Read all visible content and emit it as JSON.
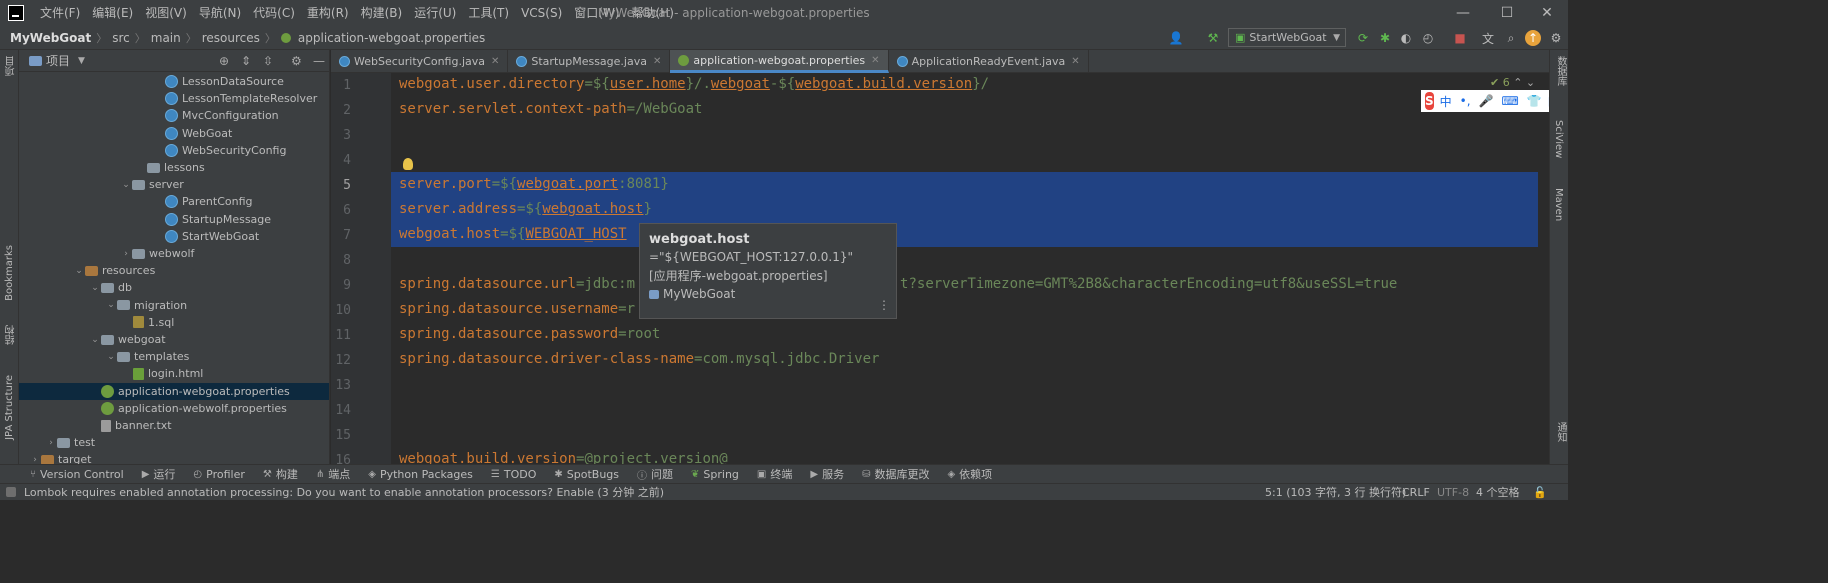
{
  "menu": [
    "文件(F)",
    "编辑(E)",
    "视图(V)",
    "导航(N)",
    "代码(C)",
    "重构(R)",
    "构建(B)",
    "运行(U)",
    "工具(T)",
    "VCS(S)",
    "窗口(W)",
    "帮助(H)"
  ],
  "window_title": "MyWebGoat - application-webgoat.properties",
  "breadcrumb": [
    "MyWebGoat",
    "src",
    "main",
    "resources",
    "application-webgoat.properties"
  ],
  "run_config": "StartWebGoat",
  "project_panel": {
    "title": "项目"
  },
  "tree": [
    {
      "label": "LessonDataSource",
      "icon": "class"
    },
    {
      "label": "LessonTemplateResolver",
      "icon": "class"
    },
    {
      "label": "MvcConfiguration",
      "icon": "class"
    },
    {
      "label": "WebGoat",
      "icon": "class"
    },
    {
      "label": "WebSecurityConfig",
      "icon": "class"
    },
    {
      "label": "lessons",
      "icon": "folder"
    },
    {
      "label": "server",
      "icon": "folder"
    },
    {
      "label": "ParentConfig",
      "icon": "class"
    },
    {
      "label": "StartupMessage",
      "icon": "class"
    },
    {
      "label": "StartWebGoat",
      "icon": "class"
    },
    {
      "label": "webwolf",
      "icon": "folder"
    },
    {
      "label": "resources",
      "icon": "resources"
    },
    {
      "label": "db",
      "icon": "folder"
    },
    {
      "label": "migration",
      "icon": "folder"
    },
    {
      "label": "1.sql",
      "icon": "sql"
    },
    {
      "label": "webgoat",
      "icon": "folder"
    },
    {
      "label": "templates",
      "icon": "folder"
    },
    {
      "label": "login.html",
      "icon": "html"
    },
    {
      "label": "application-webgoat.properties",
      "icon": "props"
    },
    {
      "label": "application-webwolf.properties",
      "icon": "props"
    },
    {
      "label": "banner.txt",
      "icon": "file"
    },
    {
      "label": "test",
      "icon": "folder"
    },
    {
      "label": "target",
      "icon": "resources"
    }
  ],
  "tabs": [
    {
      "label": "WebSecurityConfig.java",
      "active": false
    },
    {
      "label": "StartupMessage.java",
      "active": false
    },
    {
      "label": "application-webgoat.properties",
      "active": true
    },
    {
      "label": "ApplicationReadyEvent.java",
      "active": false
    }
  ],
  "code": {
    "l1a": "webgoat.user.directory",
    "l1b": "=${",
    "l1c": "user.home",
    "l1d": "}/.",
    "l1e": "webgoat",
    "l1f": "-${",
    "l1g": "webgoat.build.version",
    "l1h": "}/",
    "l2a": "server.servlet.context-path",
    "l2b": "=/WebGoat",
    "l5a": "server.port",
    "l5b": "=${",
    "l5c": "webgoat.port",
    "l5d": ":8081}",
    "l6a": "server.address",
    "l6b": "=${",
    "l6c": "webgoat.host",
    "l6d": "}",
    "l7a": "webgoat.host",
    "l7b": "=${",
    "l7c": "WEBGOAT_HOST",
    "l9a": "spring.datasource.url",
    "l9b": "=jdbc:m",
    "l9c": "t?serverTimezone=GMT%2B8&characterEncoding=utf8&useSSL=true",
    "l10a": "spring.datasource.username",
    "l10b": "=r",
    "l11a": "spring.datasource.password",
    "l11b": "=root",
    "l12a": "spring.datasource.driver-class-name",
    "l12b": "=com.mysql.jdbc.Driver",
    "l16a": "webgoat.build.version",
    "l16b": "=@project.version@"
  },
  "line_numbers": [
    "1",
    "2",
    "3",
    "4",
    "5",
    "6",
    "7",
    "8",
    "9",
    "10",
    "11",
    "12",
    "13",
    "14",
    "15",
    "16"
  ],
  "popup": {
    "name": "webgoat.host",
    "value": "=\"${WEBGOAT_HOST:127.0.0.1}\"",
    "source": "[应用程序-webgoat.properties]",
    "project": "MyWebGoat"
  },
  "inspection_count": "6",
  "ime": {
    "lang": "中"
  },
  "left_strip": [
    "项目",
    "Bookmarks",
    "结构",
    "JPA Structure"
  ],
  "right_strip": [
    "数据库",
    "SciView",
    "Maven",
    "通知"
  ],
  "tool_windows": [
    "Version Control",
    "运行",
    "Profiler",
    "构建",
    "端点",
    "Python Packages",
    "TODO",
    "SpotBugs",
    "问题",
    "Spring",
    "终端",
    "服务",
    "数据库更改",
    "依赖项"
  ],
  "status": {
    "message": "Lombok requires enabled annotation processing: Do you want to enable annotation processors? Enable (3 分钟 之前)",
    "position": "5:1 (103 字符, 3 行 换行符)",
    "line_sep": "CRLF",
    "encoding": "UTF-8",
    "indent": "4 个空格"
  }
}
